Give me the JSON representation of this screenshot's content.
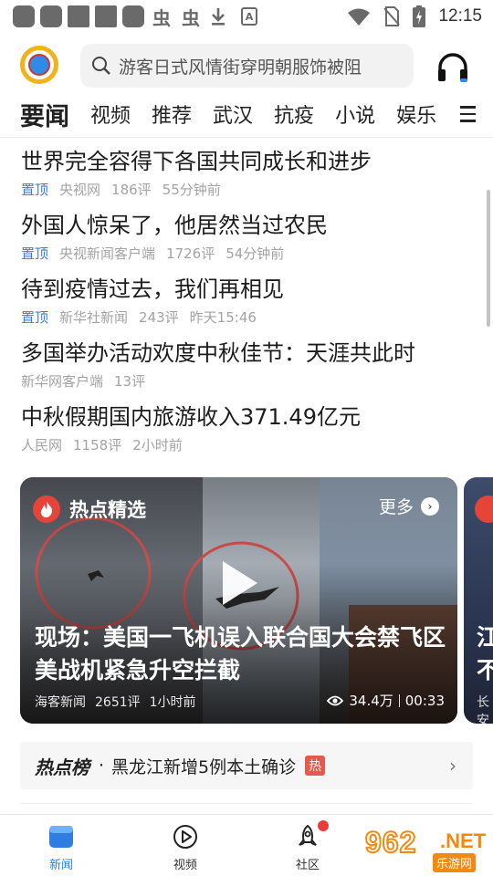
{
  "status_bar": {
    "time": "12:15",
    "left_icons": [
      "app-icon",
      "app-icon",
      "app-icon",
      "app-icon",
      "app-icon",
      "bug-icon",
      "bug-icon",
      "download-icon",
      "a-icon"
    ],
    "bug_glyph": "虫",
    "a_glyph": "A",
    "right_icons": [
      "wifi-icon",
      "no-sim-icon",
      "battery-charging-icon"
    ]
  },
  "header": {
    "search_placeholder": "游客日式风情街穿明朝服饰被阻"
  },
  "tabs": [
    "要闻",
    "视频",
    "推荐",
    "武汉",
    "抗疫",
    "小说",
    "娱乐"
  ],
  "news": [
    {
      "title": "世界完全容得下各国共同成长和进步",
      "pin": "置顶",
      "source": "央视网",
      "comments": "186评",
      "time": "55分钟前"
    },
    {
      "title": "外国人惊呆了，他居然当过农民",
      "pin": "置顶",
      "source": "央视新闻客户端",
      "comments": "1726评",
      "time": "54分钟前"
    },
    {
      "title": "待到疫情过去，我们再相见",
      "pin": "置顶",
      "source": "新华社新闻",
      "comments": "243评",
      "time": "昨天15:46"
    },
    {
      "title": "多国举办活动欢度中秋佳节：天涯共此时",
      "pin": "",
      "source": "新华网客户端",
      "comments": "13评",
      "time": ""
    },
    {
      "title": "中秋假期国内旅游收入371.49亿元",
      "pin": "",
      "source": "人民网",
      "comments": "1158评",
      "time": "2小时前"
    }
  ],
  "video_card": {
    "section_label": "热点精选",
    "more_label": "更多",
    "title": "现场：美国一飞机误入联合国大会禁飞区 美战机紧急升空拦截",
    "source": "海客新闻",
    "comments": "2651评",
    "time": "1小时前",
    "views": "34.4万",
    "duration": "00:33"
  },
  "video_card_2": {
    "title_line1": "江",
    "title_line2": "不",
    "source": "长安"
  },
  "hot_list": {
    "title": "热点榜",
    "separator": "·",
    "text": "黑龙江新增5例本土确诊",
    "tag": "热"
  },
  "bottom_nav": [
    {
      "label": "新闻",
      "active": true
    },
    {
      "label": "视频",
      "active": false
    },
    {
      "label": "社区",
      "active": false
    }
  ],
  "watermark": {
    "number": "962",
    "suffix": ".NET",
    "sub": "乐游网"
  },
  "colors": {
    "accent": "#2f7de1",
    "pin": "#3b7de0",
    "hot": "#e64339",
    "meta": "#a3a3a3"
  }
}
